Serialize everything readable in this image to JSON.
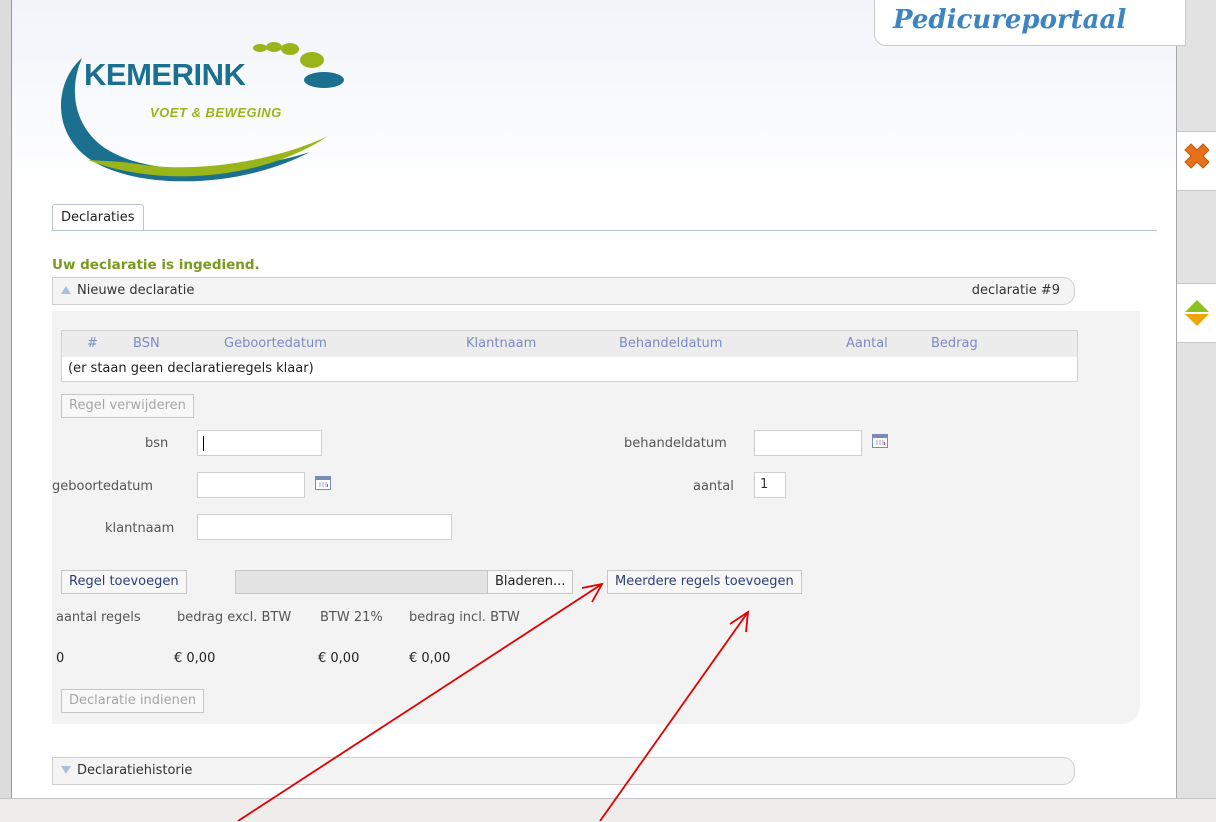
{
  "header": {
    "portal_title": "Pedicureportaal",
    "logo_title": "KEMERINK",
    "logo_subtitle": "VOET & BEWEGING"
  },
  "tabs": [
    {
      "label": "Declaraties",
      "active": true
    }
  ],
  "status_message": "Uw declaratie is ingediend.",
  "new_declaration": {
    "title": "Nieuwe declaratie",
    "number": "declaratie #9",
    "table": {
      "columns": [
        "#",
        "BSN",
        "Geboortedatum",
        "Klantnaam",
        "Behandeldatum",
        "Aantal",
        "Bedrag"
      ],
      "empty_text": "(er staan geen declaratieregels klaar)"
    },
    "remove_button": "Regel verwijderen",
    "form": {
      "bsn_label": "bsn",
      "bsn_value": "",
      "geboortedatum_label": "geboortedatum",
      "geboortedatum_value": "",
      "klantnaam_label": "klantnaam",
      "klantnaam_value": "",
      "behandeldatum_label": "behandeldatum",
      "behandeldatum_value": "",
      "aantal_label": "aantal",
      "aantal_value": "1"
    },
    "add_button": "Regel toevoegen",
    "browse_button": "Bladeren...",
    "add_multiple_button": "Meerdere regels toevoegen",
    "summary": {
      "headers": [
        "aantal regels",
        "bedrag excl. BTW",
        "BTW 21%",
        "bedrag incl. BTW"
      ],
      "values": [
        "0",
        "€ 0,00",
        "€ 0,00",
        "€ 0,00"
      ]
    },
    "submit_button": "Declaratie indienen"
  },
  "history": {
    "title": "Declaratiehistorie"
  },
  "icons": {
    "close": "close-x-icon",
    "scroll": "scroll-up-down-icon",
    "calendar": "calendar-icon",
    "panel_collapse": "triangle-up-icon",
    "panel_expand": "triangle-down-icon"
  },
  "colors": {
    "success": "#7a9a1e",
    "column_header": "#7b8cc4",
    "portal_title": "#3d84c3",
    "annotation_arrow": "#e00000",
    "close_icon": "#e8701a",
    "scroll_icon_up": "#8dc21f",
    "scroll_icon_down": "#f0a500"
  }
}
